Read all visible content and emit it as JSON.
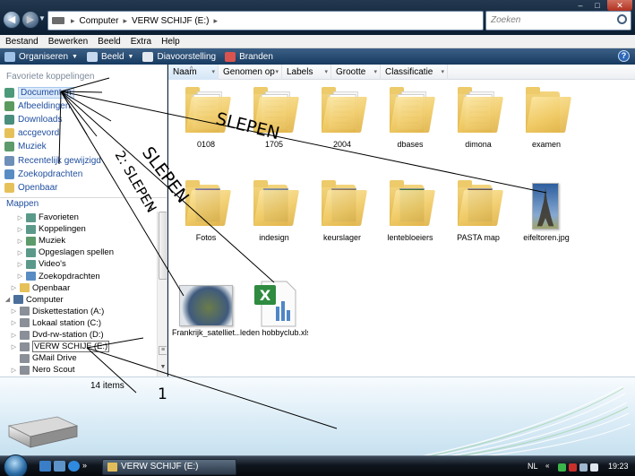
{
  "window": {
    "address_segments": [
      "Computer",
      "VERW SCHIJF (E:)"
    ],
    "search_placeholder": "Zoeken",
    "controls": [
      "–",
      "□",
      "✕"
    ]
  },
  "menubar": [
    "Bestand",
    "Bewerken",
    "Beeld",
    "Extra",
    "Help"
  ],
  "toolbar": [
    {
      "label": "Organiseren",
      "icon": "organize-icon",
      "color": "#9fc1e8",
      "dropdown": true
    },
    {
      "label": "Beeld",
      "icon": "views-icon",
      "color": "#c6d9ee",
      "dropdown": true
    },
    {
      "label": "Diavoorstelling",
      "icon": "slideshow-icon",
      "color": "#e4e9ef",
      "dropdown": false
    },
    {
      "label": "Branden",
      "icon": "burn-icon",
      "color": "#d9534f",
      "dropdown": false
    }
  ],
  "favorites": {
    "title": "Favoriete koppelingen",
    "items": [
      {
        "label": "Documenten",
        "icon": "documents-icon",
        "color": "#4d9a7a",
        "selected": true
      },
      {
        "label": "Afbeeldingen",
        "icon": "pictures-icon",
        "color": "#5b9a5e"
      },
      {
        "label": "Downloads",
        "icon": "downloads-icon",
        "color": "#4a8e7e"
      },
      {
        "label": "accgevord",
        "icon": "folder-icon",
        "color": "#e6c15a"
      },
      {
        "label": "Muziek",
        "icon": "music-icon",
        "color": "#5d9b6c"
      },
      {
        "label": "Recentelijk gewijzigd",
        "icon": "recent-icon",
        "color": "#6d8fb8"
      },
      {
        "label": "Zoekopdrachten",
        "icon": "searches-icon",
        "color": "#5a8cc4"
      },
      {
        "label": "Openbaar",
        "icon": "folder-icon",
        "color": "#e6c15a"
      }
    ]
  },
  "folders": {
    "title": "Mappen",
    "tree": [
      {
        "label": "Favorieten",
        "indent": 2,
        "icon": "favorites-icon",
        "color": "#5b9a8a",
        "twisty": "▷"
      },
      {
        "label": "Koppelingen",
        "indent": 2,
        "icon": "links-icon",
        "color": "#5b9a8a",
        "twisty": "▷"
      },
      {
        "label": "Muziek",
        "indent": 2,
        "icon": "music-icon",
        "color": "#5d9b6c",
        "twisty": "▷"
      },
      {
        "label": "Opgeslagen spellen",
        "indent": 2,
        "icon": "saved-games-icon",
        "color": "#5b9a8a",
        "twisty": "▷"
      },
      {
        "label": "Video's",
        "indent": 2,
        "icon": "videos-icon",
        "color": "#5b9a8a",
        "twisty": "▷"
      },
      {
        "label": "Zoekopdrachten",
        "indent": 2,
        "icon": "searches-icon",
        "color": "#5a8cc4",
        "twisty": "▷"
      },
      {
        "label": "Openbaar",
        "indent": 1,
        "icon": "folder-icon",
        "color": "#e6c15a",
        "twisty": "▷"
      },
      {
        "label": "Computer",
        "indent": 0,
        "icon": "computer-icon",
        "color": "#4b6f9b",
        "twisty": "◢"
      },
      {
        "label": "Diskettestation (A:)",
        "indent": 1,
        "icon": "floppy-icon",
        "color": "#8a8f98",
        "twisty": "▷"
      },
      {
        "label": "Lokaal station (C:)",
        "indent": 1,
        "icon": "harddisk-icon",
        "color": "#8a8f98",
        "twisty": "▷"
      },
      {
        "label": "Dvd-rw-station (D:)",
        "indent": 1,
        "icon": "dvd-icon",
        "color": "#8a8f98",
        "twisty": "▷"
      },
      {
        "label": "VERW SCHIJF (E:)",
        "indent": 1,
        "icon": "removable-drive-icon",
        "color": "#8a8f98",
        "twisty": "▷",
        "selected": true
      },
      {
        "label": "GMail Drive",
        "indent": 1,
        "icon": "gmail-drive-icon",
        "color": "#8a8f98",
        "twisty": ""
      },
      {
        "label": "Nero Scout",
        "indent": 1,
        "icon": "nero-scout-icon",
        "color": "#8a8f98",
        "twisty": "▷"
      }
    ]
  },
  "columns": [
    "Naam",
    "Genomen op",
    "Labels",
    "Grootte",
    "Classificatie"
  ],
  "files": [
    {
      "name": "0108",
      "kind": "folder",
      "thumb": "doc"
    },
    {
      "name": "1705",
      "kind": "folder",
      "thumb": "doc"
    },
    {
      "name": "2004",
      "kind": "folder",
      "thumb": "doc"
    },
    {
      "name": "dbases",
      "kind": "folder",
      "thumb": "doc"
    },
    {
      "name": "dimona",
      "kind": "folder",
      "thumb": "doc"
    },
    {
      "name": "examen",
      "kind": "folder",
      "thumb": "empty"
    },
    {
      "name": "Fotos",
      "kind": "folder",
      "thumb": "photo",
      "color": "#8b6fa6"
    },
    {
      "name": "indesign",
      "kind": "folder",
      "thumb": "photo",
      "color": "#7a8fa8"
    },
    {
      "name": "keurslager",
      "kind": "folder",
      "thumb": "photo",
      "color": "#a07c55"
    },
    {
      "name": "lentebloeiers",
      "kind": "folder",
      "thumb": "photo",
      "color": "#3e7a3a"
    },
    {
      "name": "PASTA map",
      "kind": "folder",
      "thumb": "photo",
      "color": "#7a5a48"
    },
    {
      "name": "eifeltoren.jpg",
      "kind": "image",
      "thumb": "tower"
    },
    {
      "name": "Frankrijk_satelliet....",
      "kind": "image",
      "thumb": "satellite"
    },
    {
      "name": "leden hobbyclub.xls",
      "kind": "excel",
      "thumb": "excel"
    }
  ],
  "status": {
    "count_text": "14 items"
  },
  "annotations": [
    "SLEPEN",
    "SLEPEN",
    "2: SLEPEN",
    "1"
  ],
  "taskbar": {
    "task_label": "VERW SCHIJF (E:)",
    "language": "NL",
    "clock": "19:23"
  }
}
